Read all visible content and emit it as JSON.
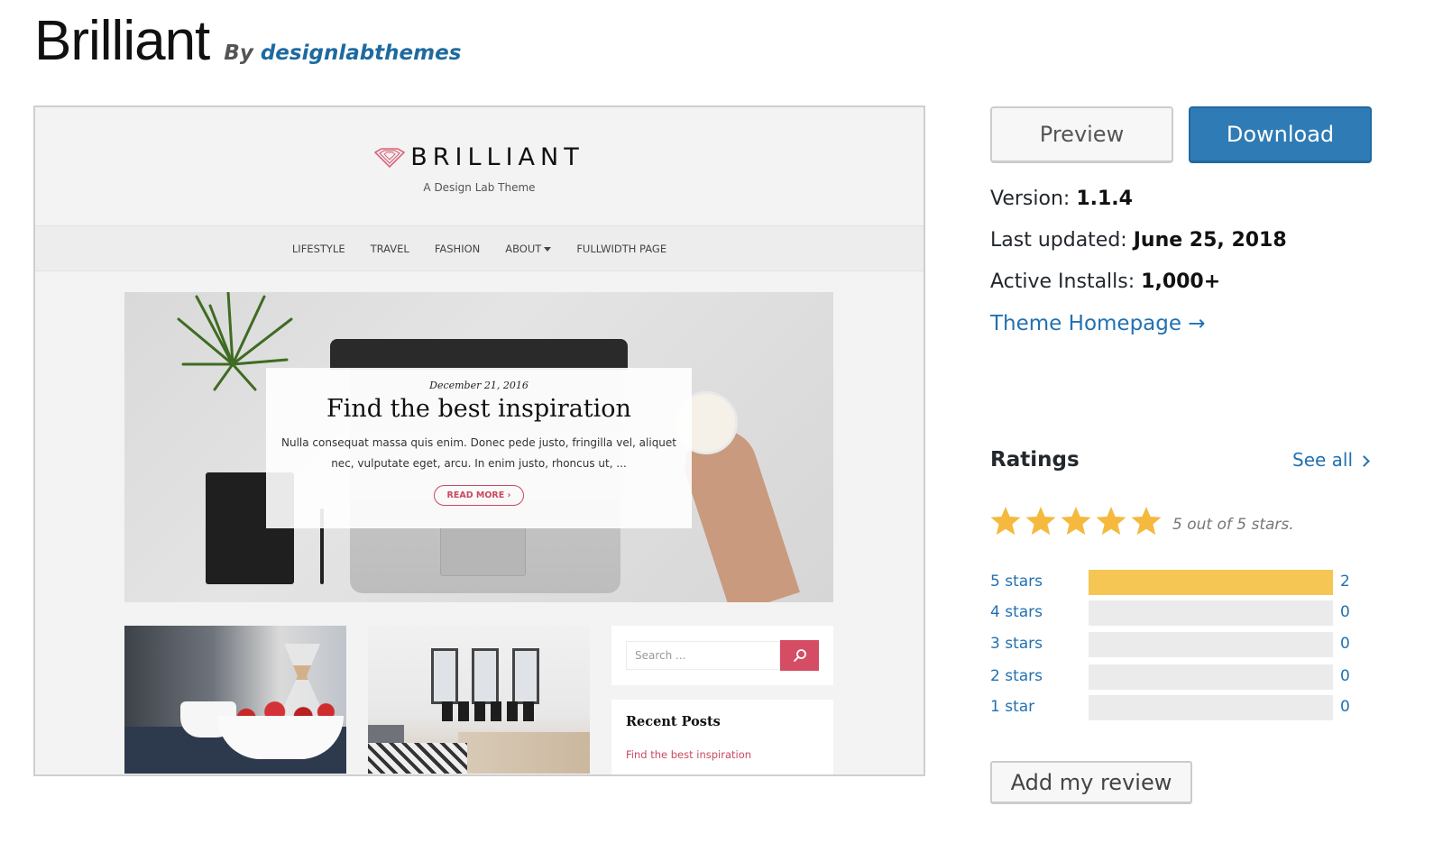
{
  "header": {
    "theme_name": "Brilliant",
    "by_prefix": "By",
    "author": "designlabthemes"
  },
  "screenshot": {
    "logo_text": "BRILLIANT",
    "tagline": "A Design Lab Theme",
    "nav": [
      "LIFESTYLE",
      "TRAVEL",
      "FASHION",
      "ABOUT",
      "FULLWIDTH PAGE"
    ],
    "hero": {
      "date": "December 21, 2016",
      "title": "Find the best inspiration",
      "excerpt": "Nulla consequat massa quis enim. Donec pede justo, fringilla vel, aliquet nec, vulputate eget, arcu. In enim justo, rhoncus ut, ...",
      "read_more": "READ MORE ›"
    },
    "search_placeholder": "Search ...",
    "recent_posts_title": "Recent Posts",
    "recent_post_link": "Find the best inspiration",
    "accent_color": "#d44d64"
  },
  "actions": {
    "preview_label": "Preview",
    "download_label": "Download"
  },
  "meta": {
    "version_label": "Version:",
    "version": "1.1.4",
    "updated_label": "Last updated:",
    "updated": "June 25, 2018",
    "installs_label": "Active Installs:",
    "installs": "1,000+",
    "homepage_link": "Theme Homepage →"
  },
  "ratings": {
    "heading": "Ratings",
    "see_all": "See all",
    "average_stars": 5,
    "max_stars": 5,
    "caption": "5 out of 5 stars.",
    "star_color": "#f5b93e",
    "bar_color": "#f5c653",
    "rows": [
      {
        "label": "5 stars",
        "count": "2",
        "fraction": 1.0
      },
      {
        "label": "4 stars",
        "count": "0",
        "fraction": 0
      },
      {
        "label": "3 stars",
        "count": "0",
        "fraction": 0
      },
      {
        "label": "2 stars",
        "count": "0",
        "fraction": 0
      },
      {
        "label": "1 star",
        "count": "0",
        "fraction": 0
      }
    ],
    "add_review": "Add my review"
  }
}
